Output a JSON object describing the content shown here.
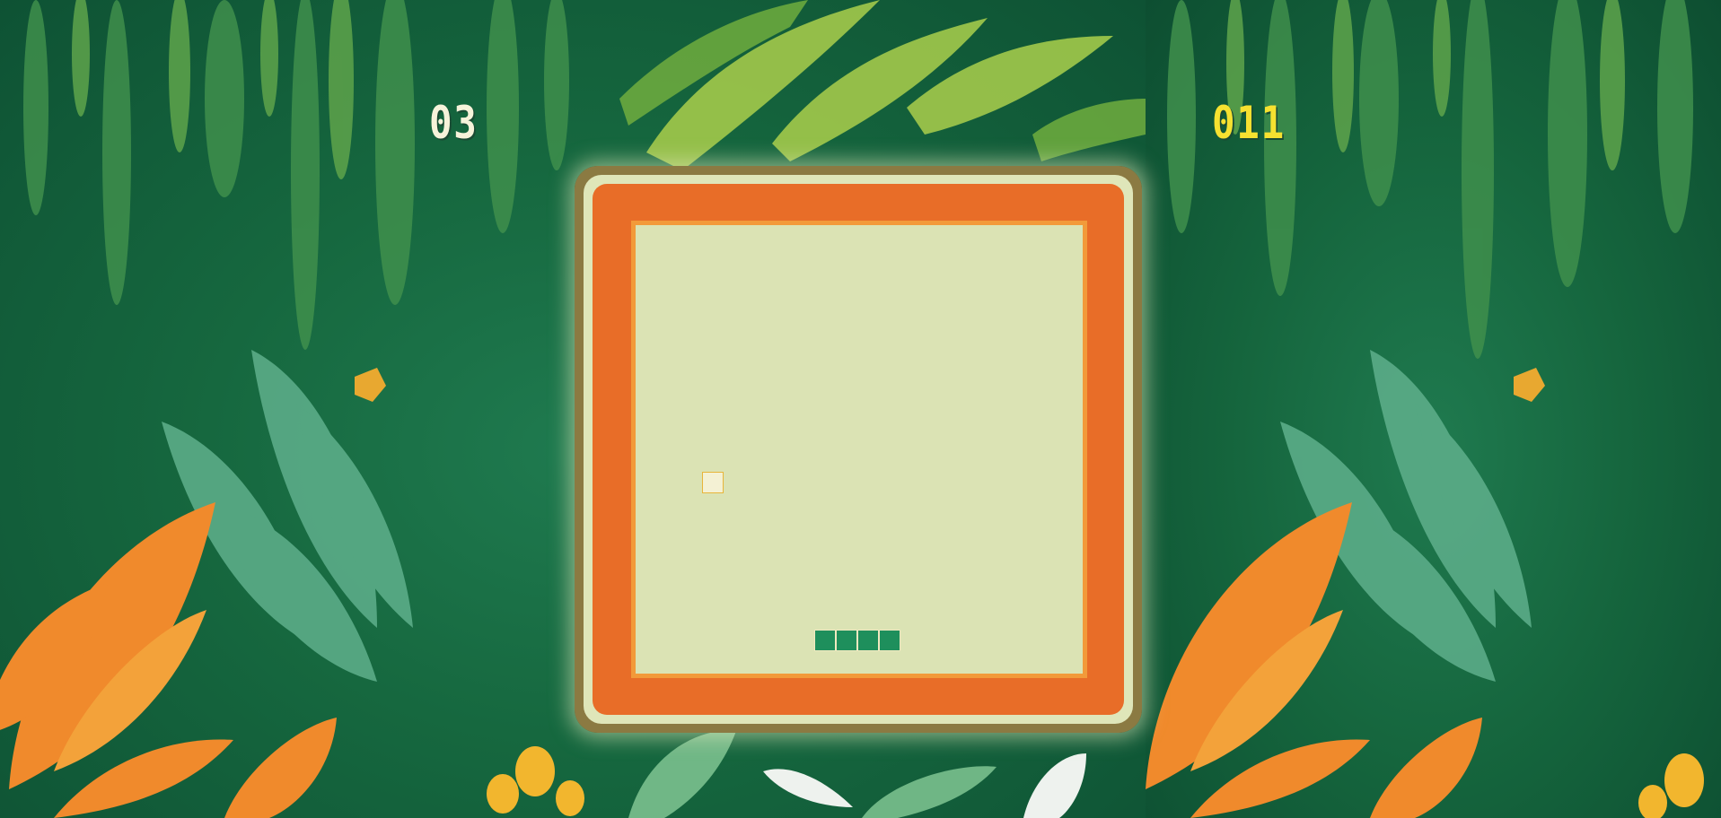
{
  "game": {
    "player_score": "03",
    "high_score": "011"
  },
  "board": {
    "snake_length": 4,
    "food_count": 1
  },
  "colors": {
    "background": "#16683f",
    "frame_outer": "#8b7a42",
    "frame_orange": "#e86d28",
    "play_area": "#dbe3b4",
    "play_border": "#f29a3a",
    "snake": "#1e8f5c",
    "food": "#f4f1d4",
    "player_score": "#f6f3da",
    "high_score": "#f6e130"
  }
}
